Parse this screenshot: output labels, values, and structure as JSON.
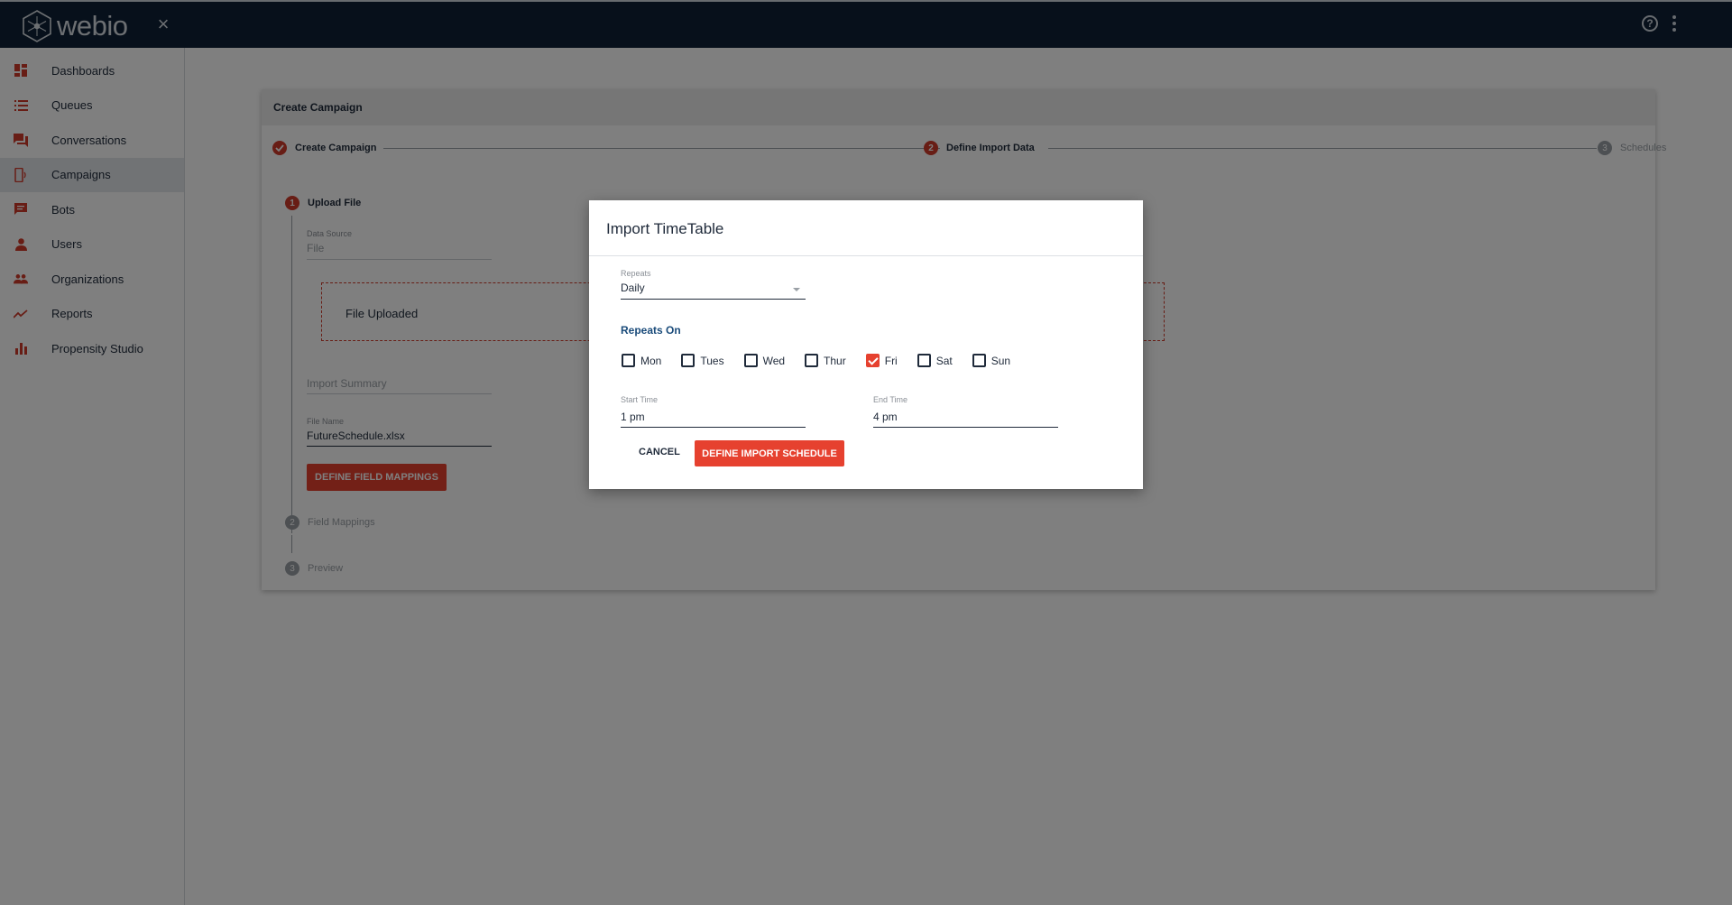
{
  "app": {
    "logo_text": "webio"
  },
  "sidebar": {
    "items": [
      {
        "label": "Dashboards",
        "icon": "dashboard-icon"
      },
      {
        "label": "Queues",
        "icon": "list-icon"
      },
      {
        "label": "Conversations",
        "icon": "chat-icon"
      },
      {
        "label": "Campaigns",
        "icon": "campaign-icon",
        "active": true
      },
      {
        "label": "Bots",
        "icon": "bot-icon"
      },
      {
        "label": "Users",
        "icon": "user-icon"
      },
      {
        "label": "Organizations",
        "icon": "group-icon"
      },
      {
        "label": "Reports",
        "icon": "trend-icon"
      },
      {
        "label": "Propensity Studio",
        "icon": "bar-chart-icon"
      }
    ]
  },
  "card": {
    "title": "Create Campaign",
    "steps": [
      {
        "label": "Create Campaign",
        "state": "done"
      },
      {
        "number": "2",
        "label": "Define Import Data",
        "state": "active"
      },
      {
        "number": "3",
        "label": "Schedules",
        "state": "pending"
      }
    ],
    "substeps": [
      {
        "number": "1",
        "label": "Upload File"
      },
      {
        "number": "2",
        "label": "Field Mappings"
      },
      {
        "number": "3",
        "label": "Preview"
      }
    ],
    "data_source_label": "Data Source",
    "data_source_value": "File",
    "upload_status": "File Uploaded",
    "import_summary_label": "Import Summary",
    "file_name_label": "File Name",
    "file_name_value": "FutureSchedule.xlsx",
    "define_mappings_button": "DEFINE FIELD MAPPINGS"
  },
  "dialog": {
    "title": "Import TimeTable",
    "repeats_label": "Repeats",
    "repeats_value": "Daily",
    "repeats_on_title": "Repeats On",
    "days": [
      {
        "label": "Mon",
        "checked": false
      },
      {
        "label": "Tues",
        "checked": false
      },
      {
        "label": "Wed",
        "checked": false
      },
      {
        "label": "Thur",
        "checked": false
      },
      {
        "label": "Fri",
        "checked": true
      },
      {
        "label": "Sat",
        "checked": false
      },
      {
        "label": "Sun",
        "checked": false
      }
    ],
    "start_time_label": "Start Time",
    "start_time_value": "1 pm",
    "end_time_label": "End Time",
    "end_time_value": "4 pm",
    "cancel_label": "CANCEL",
    "submit_label": "DEFINE IMPORT SCHEDULE"
  },
  "colors": {
    "accent": "#e6412f",
    "topbar": "#0f2137",
    "link_blue": "#1a4b7a"
  }
}
